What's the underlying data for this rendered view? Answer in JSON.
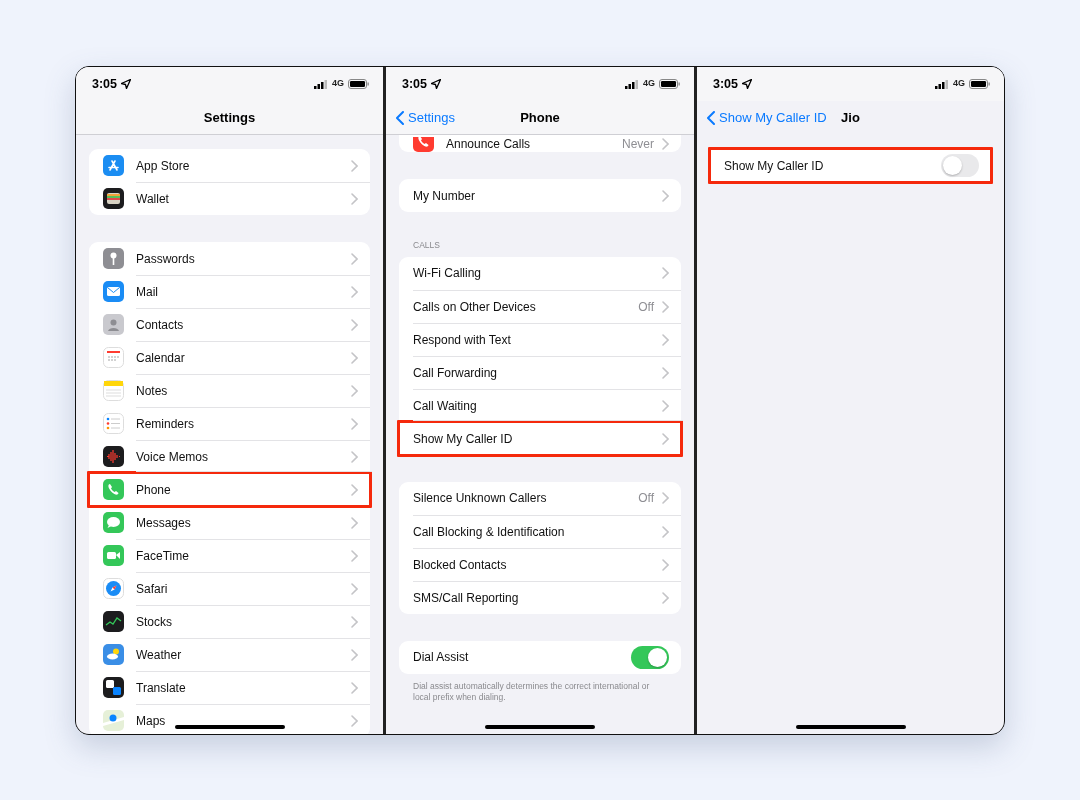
{
  "panels": [
    {
      "status_bar": {
        "time": "3:05",
        "network": "4G"
      },
      "nav": {
        "title": "Settings",
        "separator": true
      },
      "groups": [
        {
          "rows": [
            {
              "label": "App Store",
              "kind": "link",
              "has_icon": true,
              "highlighted": false
            },
            {
              "label": "Wallet",
              "kind": "link",
              "has_icon": true,
              "highlighted": false
            }
          ]
        },
        {
          "rows": [
            {
              "label": "Passwords",
              "kind": "link",
              "has_icon": true,
              "highlighted": false
            },
            {
              "label": "Mail",
              "kind": "link",
              "has_icon": true,
              "highlighted": false
            },
            {
              "label": "Contacts",
              "kind": "link",
              "has_icon": true,
              "highlighted": false
            },
            {
              "label": "Calendar",
              "kind": "link",
              "has_icon": true,
              "highlighted": false
            },
            {
              "label": "Notes",
              "kind": "link",
              "has_icon": true,
              "highlighted": false
            },
            {
              "label": "Reminders",
              "kind": "link",
              "has_icon": true,
              "highlighted": false
            },
            {
              "label": "Voice Memos",
              "kind": "link",
              "has_icon": true,
              "highlighted": false
            },
            {
              "label": "Phone",
              "kind": "link",
              "has_icon": true,
              "highlighted": true
            },
            {
              "label": "Messages",
              "kind": "link",
              "has_icon": true,
              "highlighted": false
            },
            {
              "label": "FaceTime",
              "kind": "link",
              "has_icon": true,
              "highlighted": false
            },
            {
              "label": "Safari",
              "kind": "link",
              "has_icon": true,
              "highlighted": false
            },
            {
              "label": "Stocks",
              "kind": "link",
              "has_icon": true,
              "highlighted": false
            },
            {
              "label": "Weather",
              "kind": "link",
              "has_icon": true,
              "highlighted": false
            },
            {
              "label": "Translate",
              "kind": "link",
              "has_icon": true,
              "highlighted": false
            },
            {
              "label": "Maps",
              "kind": "link",
              "has_icon": true,
              "highlighted": false
            }
          ]
        }
      ]
    },
    {
      "status_bar": {
        "time": "3:05",
        "network": "4G"
      },
      "nav": {
        "back": "Settings",
        "title": "Phone",
        "separator": true
      },
      "groups": [
        {
          "rows": [
            {
              "label": "Announce Calls",
              "value": "Never",
              "kind": "link",
              "has_icon": true,
              "highlighted": false
            }
          ]
        },
        {
          "rows": [
            {
              "label": "My Number",
              "kind": "link",
              "highlighted": false
            }
          ]
        },
        {
          "header": "CALLS",
          "rows": [
            {
              "label": "Wi-Fi Calling",
              "kind": "link",
              "highlighted": false
            },
            {
              "label": "Calls on Other Devices",
              "value": "Off",
              "kind": "link",
              "highlighted": false
            },
            {
              "label": "Respond with Text",
              "kind": "link",
              "highlighted": false
            },
            {
              "label": "Call Forwarding",
              "kind": "link",
              "highlighted": false
            },
            {
              "label": "Call Waiting",
              "kind": "link",
              "highlighted": false
            },
            {
              "label": "Show My Caller ID",
              "kind": "link",
              "highlighted": true
            }
          ]
        },
        {
          "rows": [
            {
              "label": "Silence Unknown Callers",
              "value": "Off",
              "kind": "link",
              "highlighted": false
            },
            {
              "label": "Call Blocking & Identification",
              "kind": "link",
              "highlighted": false
            },
            {
              "label": "Blocked Contacts",
              "kind": "link",
              "highlighted": false
            },
            {
              "label": "SMS/Call Reporting",
              "kind": "link",
              "highlighted": false
            }
          ]
        },
        {
          "rows": [
            {
              "label": "Dial Assist",
              "kind": "toggle",
              "on": true,
              "highlighted": false
            }
          ],
          "footer": "Dial assist automatically determines the correct international or local prefix when dialing."
        }
      ]
    },
    {
      "status_bar": {
        "time": "3:05",
        "network": "4G"
      },
      "nav": {
        "back": "Show My Caller ID",
        "title": "Jio",
        "separator": false
      },
      "groups": [
        {
          "rows": [
            {
              "label": "Show My Caller ID",
              "kind": "toggle",
              "on": false,
              "highlighted": true
            }
          ]
        }
      ]
    }
  ]
}
